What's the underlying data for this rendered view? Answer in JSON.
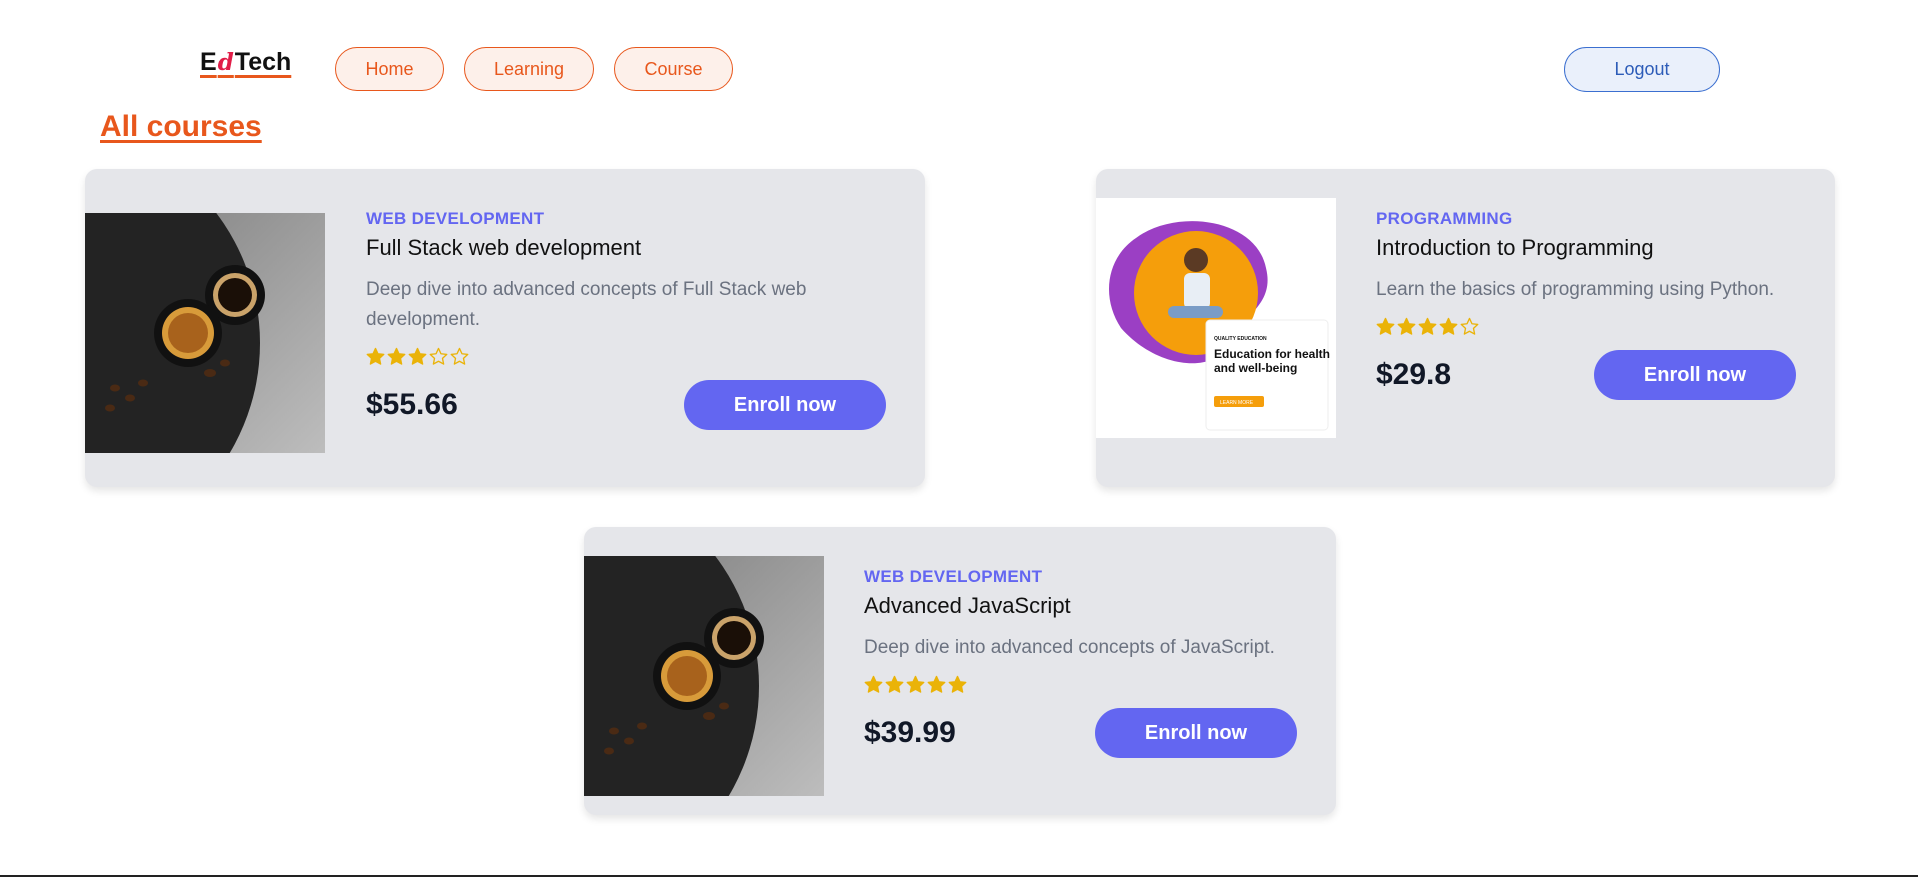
{
  "header": {
    "logo": {
      "first": "E",
      "middle": "d",
      "rest": "Tech"
    },
    "nav": [
      {
        "label": "Home"
      },
      {
        "label": "Learning"
      },
      {
        "label": "Course"
      }
    ],
    "logout_label": "Logout"
  },
  "main": {
    "title": "All courses",
    "courses": [
      {
        "category": "WEB DEVELOPMENT",
        "title": "Full Stack web development",
        "description": "Deep dive into advanced concepts of Full Stack web development.",
        "rating": 3,
        "rating_max": 5,
        "price": "$55.66",
        "button": "Enroll now",
        "image": "coffee-cups-photo"
      },
      {
        "category": "PROGRAMMING",
        "title": "Introduction to Programming",
        "description": "Learn the basics of programming using Python.",
        "rating": 4,
        "rating_max": 5,
        "price": "$29.8",
        "button": "Enroll now",
        "image": "education-poster",
        "image_text": {
          "kicker": "QUALITY EDUCATION",
          "headline": "Education for health and well-being",
          "button": "LEARN MORE"
        }
      },
      {
        "category": "WEB DEVELOPMENT",
        "title": "Advanced JavaScript",
        "description": "Deep dive into advanced concepts of JavaScript.",
        "rating": 5,
        "rating_max": 5,
        "price": "$39.99",
        "button": "Enroll now",
        "image": "coffee-cups-photo"
      }
    ]
  },
  "colors": {
    "accent": "#e8571c",
    "primary": "#6366f1",
    "star": "#eab308",
    "card_bg": "#e5e6ea"
  }
}
